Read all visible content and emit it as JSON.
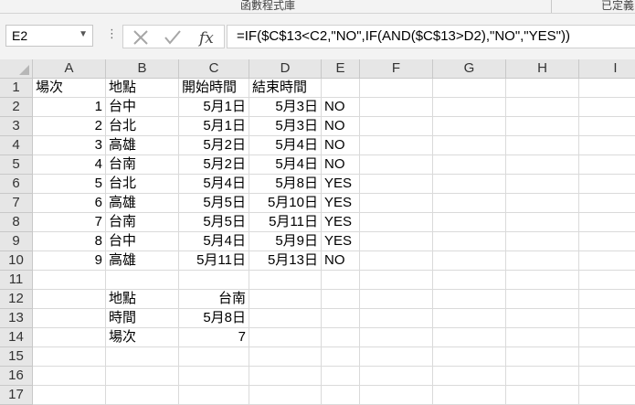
{
  "ribbon": {
    "group_label": "函數程式庫",
    "right_label": "已定義"
  },
  "formula_bar": {
    "name_box": "E2",
    "formula": "=IF($C$13<C2,\"NO\",IF(AND($C$13>D2),\"NO\",\"YES\"))"
  },
  "columns": [
    "A",
    "B",
    "C",
    "D",
    "E",
    "F",
    "G",
    "H",
    "I"
  ],
  "rows": [
    "1",
    "2",
    "3",
    "4",
    "5",
    "6",
    "7",
    "8",
    "9",
    "10",
    "11",
    "12",
    "13",
    "14",
    "15",
    "16",
    "17"
  ],
  "cells": [
    [
      "場次",
      "地點",
      "開始時間",
      "結束時間",
      "",
      "",
      "",
      "",
      ""
    ],
    [
      "1",
      "台中",
      "5月1日",
      "5月3日",
      "NO",
      "",
      "",
      "",
      ""
    ],
    [
      "2",
      "台北",
      "5月1日",
      "5月3日",
      "NO",
      "",
      "",
      "",
      ""
    ],
    [
      "3",
      "高雄",
      "5月2日",
      "5月4日",
      "NO",
      "",
      "",
      "",
      ""
    ],
    [
      "4",
      "台南",
      "5月2日",
      "5月4日",
      "NO",
      "",
      "",
      "",
      ""
    ],
    [
      "5",
      "台北",
      "5月4日",
      "5月8日",
      "YES",
      "",
      "",
      "",
      ""
    ],
    [
      "6",
      "高雄",
      "5月5日",
      "5月10日",
      "YES",
      "",
      "",
      "",
      ""
    ],
    [
      "7",
      "台南",
      "5月5日",
      "5月11日",
      "YES",
      "",
      "",
      "",
      ""
    ],
    [
      "8",
      "台中",
      "5月4日",
      "5月9日",
      "YES",
      "",
      "",
      "",
      ""
    ],
    [
      "9",
      "高雄",
      "5月11日",
      "5月13日",
      "NO",
      "",
      "",
      "",
      ""
    ],
    [
      "",
      "",
      "",
      "",
      "",
      "",
      "",
      "",
      ""
    ],
    [
      "",
      "地點",
      "台南",
      "",
      "",
      "",
      "",
      "",
      ""
    ],
    [
      "",
      "時間",
      "5月8日",
      "",
      "",
      "",
      "",
      "",
      ""
    ],
    [
      "",
      "場次",
      "7",
      "",
      "",
      "",
      "",
      "",
      ""
    ],
    [
      "",
      "",
      "",
      "",
      "",
      "",
      "",
      "",
      ""
    ],
    [
      "",
      "",
      "",
      "",
      "",
      "",
      "",
      "",
      ""
    ],
    [
      "",
      "",
      "",
      "",
      "",
      "",
      "",
      "",
      ""
    ]
  ],
  "icons": {
    "cancel": "x-icon",
    "enter": "check-icon",
    "function": "fx-icon",
    "namebox_dropdown": "chevron-down-icon",
    "more": "vertical-dots-icon",
    "select_all": "select-all-triangle-icon"
  }
}
